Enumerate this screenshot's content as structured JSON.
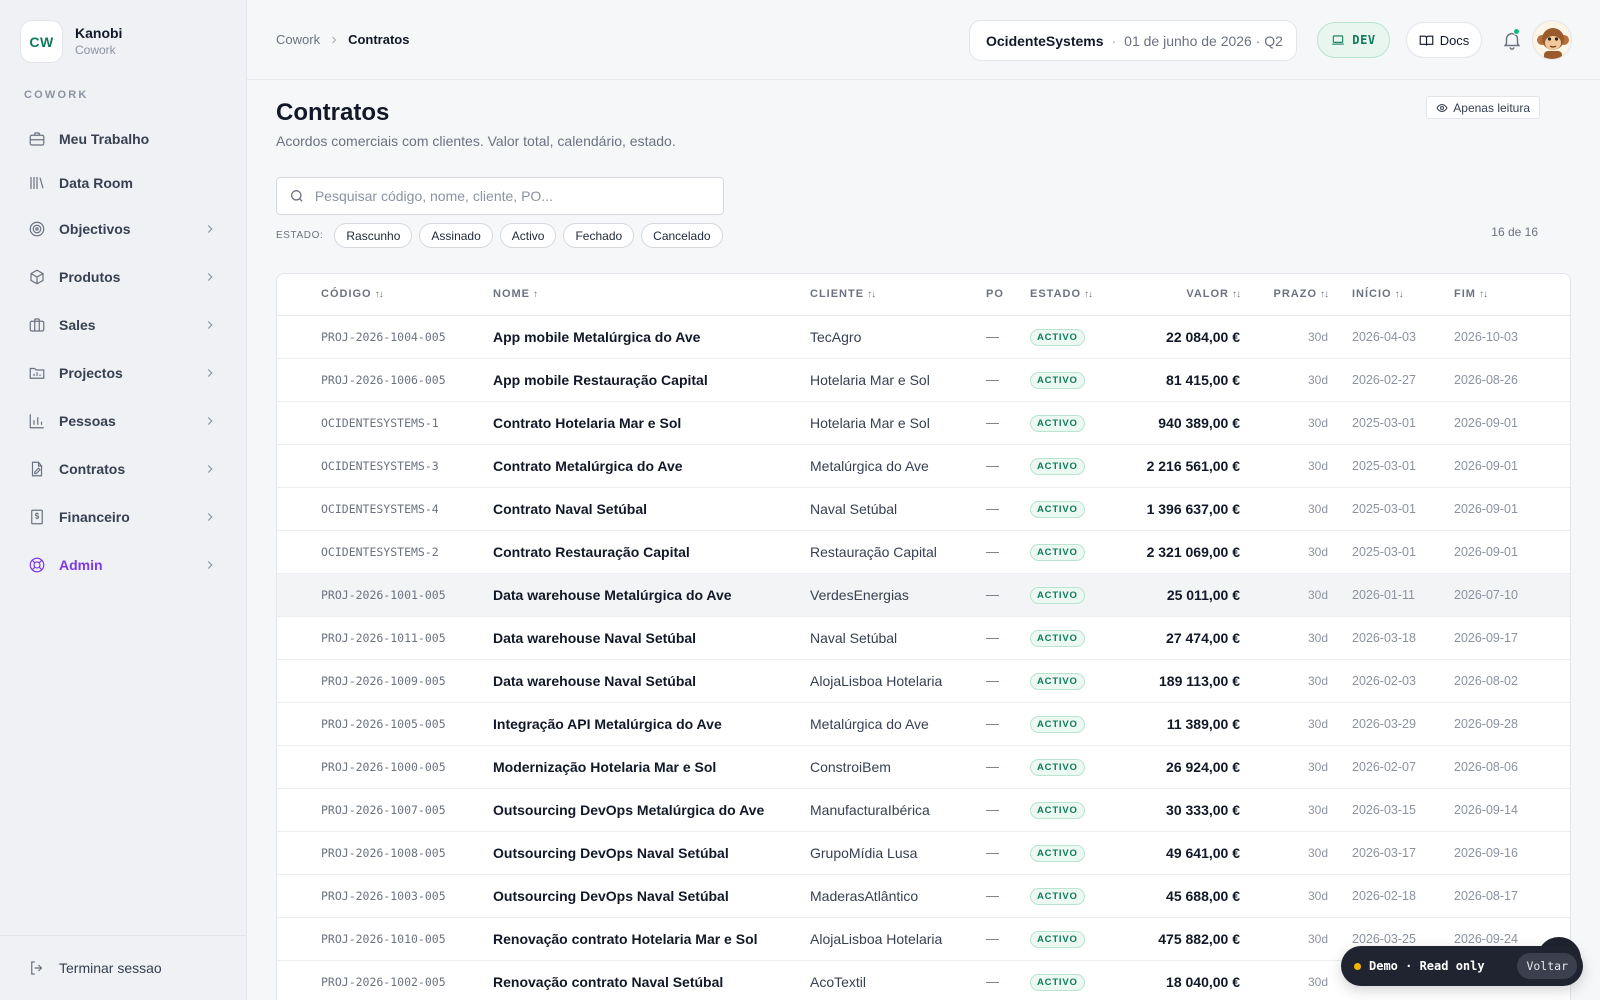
{
  "brand": {
    "logo": "CW",
    "name": "Kanobi",
    "sub": "Cowork"
  },
  "sidebar": {
    "section": "COWORK",
    "items": [
      {
        "label": "Meu Trabalho",
        "icon": "briefcase-icon"
      },
      {
        "label": "Data Room",
        "icon": "library-icon"
      },
      {
        "label": "Objectivos",
        "icon": "target-icon"
      },
      {
        "label": "Produtos",
        "icon": "package-icon"
      },
      {
        "label": "Sales",
        "icon": "briefcase-icon"
      },
      {
        "label": "Projectos",
        "icon": "folder-icon"
      },
      {
        "label": "Pessoas",
        "icon": "bar-chart-icon"
      },
      {
        "label": "Contratos",
        "icon": "file-edit-icon"
      },
      {
        "label": "Financeiro",
        "icon": "dollar-icon"
      },
      {
        "label": "Admin",
        "icon": "lifebuoy-icon"
      }
    ],
    "logout": "Terminar sessao"
  },
  "topbar": {
    "breadcrumb": [
      "Cowork",
      "Contratos"
    ],
    "org": "OcidenteSystems",
    "date": "01 de junho de 2026 · Q2",
    "env": "DEV",
    "docs": "Docs"
  },
  "page": {
    "title": "Contratos",
    "subtitle": "Acordos comerciais com clientes. Valor total, calendário, estado.",
    "readonly": "Apenas leitura",
    "search_placeholder": "Pesquisar código, nome, cliente, PO...",
    "filter_label": "ESTADO:",
    "filters": [
      "Rascunho",
      "Assinado",
      "Activo",
      "Fechado",
      "Cancelado"
    ],
    "count": "16 de 16"
  },
  "table": {
    "headers": {
      "code": "CÓDIGO",
      "name": "NOME",
      "client": "CLIENTE",
      "po": "PO",
      "status": "ESTADO",
      "value": "VALOR",
      "term": "PRAZO",
      "start": "INÍCIO",
      "end": "FIM"
    },
    "rows": [
      {
        "code": "PROJ-2026-1004-005",
        "name": "App mobile Metalúrgica do Ave",
        "client": "TecAgro",
        "po": "—",
        "status": "ACTIVO",
        "value": "22 084,00 €",
        "term": "30d",
        "start": "2026-04-03",
        "end": "2026-10-03"
      },
      {
        "code": "PROJ-2026-1006-005",
        "name": "App mobile Restauração Capital",
        "client": "Hotelaria Mar e Sol",
        "po": "—",
        "status": "ACTIVO",
        "value": "81 415,00 €",
        "term": "30d",
        "start": "2026-02-27",
        "end": "2026-08-26"
      },
      {
        "code": "OCIDENTESYSTEMS-1",
        "name": "Contrato Hotelaria Mar e Sol",
        "client": "Hotelaria Mar e Sol",
        "po": "—",
        "status": "ACTIVO",
        "value": "940 389,00 €",
        "term": "30d",
        "start": "2025-03-01",
        "end": "2026-09-01"
      },
      {
        "code": "OCIDENTESYSTEMS-3",
        "name": "Contrato Metalúrgica do Ave",
        "client": "Metalúrgica do Ave",
        "po": "—",
        "status": "ACTIVO",
        "value": "2 216 561,00 €",
        "term": "30d",
        "start": "2025-03-01",
        "end": "2026-09-01"
      },
      {
        "code": "OCIDENTESYSTEMS-4",
        "name": "Contrato Naval Setúbal",
        "client": "Naval Setúbal",
        "po": "—",
        "status": "ACTIVO",
        "value": "1 396 637,00 €",
        "term": "30d",
        "start": "2025-03-01",
        "end": "2026-09-01"
      },
      {
        "code": "OCIDENTESYSTEMS-2",
        "name": "Contrato Restauração Capital",
        "client": "Restauração Capital",
        "po": "—",
        "status": "ACTIVO",
        "value": "2 321 069,00 €",
        "term": "30d",
        "start": "2025-03-01",
        "end": "2026-09-01"
      },
      {
        "code": "PROJ-2026-1001-005",
        "name": "Data warehouse Metalúrgica do Ave",
        "client": "VerdesEnergias",
        "po": "—",
        "status": "ACTIVO",
        "value": "25 011,00 €",
        "term": "30d",
        "start": "2026-01-11",
        "end": "2026-07-10"
      },
      {
        "code": "PROJ-2026-1011-005",
        "name": "Data warehouse Naval Setúbal",
        "client": "Naval Setúbal",
        "po": "—",
        "status": "ACTIVO",
        "value": "27 474,00 €",
        "term": "30d",
        "start": "2026-03-18",
        "end": "2026-09-17"
      },
      {
        "code": "PROJ-2026-1009-005",
        "name": "Data warehouse Naval Setúbal",
        "client": "AlojaLisboa Hotelaria",
        "po": "—",
        "status": "ACTIVO",
        "value": "189 113,00 €",
        "term": "30d",
        "start": "2026-02-03",
        "end": "2026-08-02"
      },
      {
        "code": "PROJ-2026-1005-005",
        "name": "Integração API Metalúrgica do Ave",
        "client": "Metalúrgica do Ave",
        "po": "—",
        "status": "ACTIVO",
        "value": "11 389,00 €",
        "term": "30d",
        "start": "2026-03-29",
        "end": "2026-09-28"
      },
      {
        "code": "PROJ-2026-1000-005",
        "name": "Modernização Hotelaria Mar e Sol",
        "client": "ConstroiBem",
        "po": "—",
        "status": "ACTIVO",
        "value": "26 924,00 €",
        "term": "30d",
        "start": "2026-02-07",
        "end": "2026-08-06"
      },
      {
        "code": "PROJ-2026-1007-005",
        "name": "Outsourcing DevOps Metalúrgica do Ave",
        "client": "ManufacturaIbérica",
        "po": "—",
        "status": "ACTIVO",
        "value": "30 333,00 €",
        "term": "30d",
        "start": "2026-03-15",
        "end": "2026-09-14"
      },
      {
        "code": "PROJ-2026-1008-005",
        "name": "Outsourcing DevOps Naval Setúbal",
        "client": "GrupoMídia Lusa",
        "po": "—",
        "status": "ACTIVO",
        "value": "49 641,00 €",
        "term": "30d",
        "start": "2026-03-17",
        "end": "2026-09-16"
      },
      {
        "code": "PROJ-2026-1003-005",
        "name": "Outsourcing DevOps Naval Setúbal",
        "client": "MaderasAtlântico",
        "po": "—",
        "status": "ACTIVO",
        "value": "45 688,00 €",
        "term": "30d",
        "start": "2026-02-18",
        "end": "2026-08-17"
      },
      {
        "code": "PROJ-2026-1010-005",
        "name": "Renovação contrato Hotelaria Mar e Sol",
        "client": "AlojaLisboa Hotelaria",
        "po": "—",
        "status": "ACTIVO",
        "value": "475 882,00 €",
        "term": "30d",
        "start": "2026-03-25",
        "end": "2026-09-24"
      },
      {
        "code": "PROJ-2026-1002-005",
        "name": "Renovação contrato Naval Setúbal",
        "client": "AcoTextil",
        "po": "—",
        "status": "ACTIVO",
        "value": "18 040,00 €",
        "term": "30d",
        "start": "",
        "end": ""
      }
    ]
  },
  "demo": {
    "text": "Demo · Read only",
    "button": "Voltar"
  },
  "colors": {
    "accent": "#0f7a5c",
    "admin": "#7c3aed",
    "demo_dot": "#f5b400"
  }
}
